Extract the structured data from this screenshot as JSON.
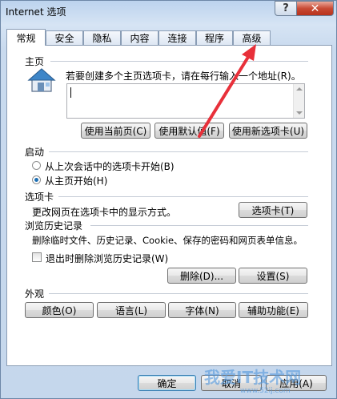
{
  "window": {
    "title": "Internet 选项",
    "help": "?",
    "close": "✕"
  },
  "tabs": [
    "常规",
    "安全",
    "隐私",
    "内容",
    "连接",
    "程序",
    "高级"
  ],
  "home": {
    "section": "主页",
    "description": "若要创建多个主页选项卡，请在每行输入一个地址(R)。",
    "use_current": "使用当前页(C)",
    "use_default": "使用默认值(F)",
    "use_new_tab": "使用新选项卡(U)"
  },
  "startup": {
    "section": "启动",
    "option1": "从上次会话中的选项卡开始(B)",
    "option2": "从主页开始(H)",
    "selected": "option2"
  },
  "tabs_section": {
    "section": "选项卡",
    "description": "更改网页在选项卡中的显示方式。",
    "button": "选项卡(T)"
  },
  "history": {
    "section": "浏览历史记录",
    "description": "删除临时文件、历史记录、Cookie、保存的密码和网页表单信息。",
    "checkbox": "退出时删除浏览历史记录(W)",
    "checked": false,
    "delete": "删除(D)...",
    "settings": "设置(S)"
  },
  "appearance": {
    "section": "外观",
    "colors": "颜色(O)",
    "languages": "语言(L)",
    "fonts": "字体(N)",
    "accessibility": "辅助功能(E)"
  },
  "footer": {
    "ok": "确定",
    "cancel": "取消",
    "apply": "应用(A)"
  },
  "watermark": {
    "text": "我爱IT技术网",
    "url": "www.52ij.com"
  },
  "colors": {
    "annotation_arrow": "#e8303a",
    "accent": "#3c7fb1"
  }
}
